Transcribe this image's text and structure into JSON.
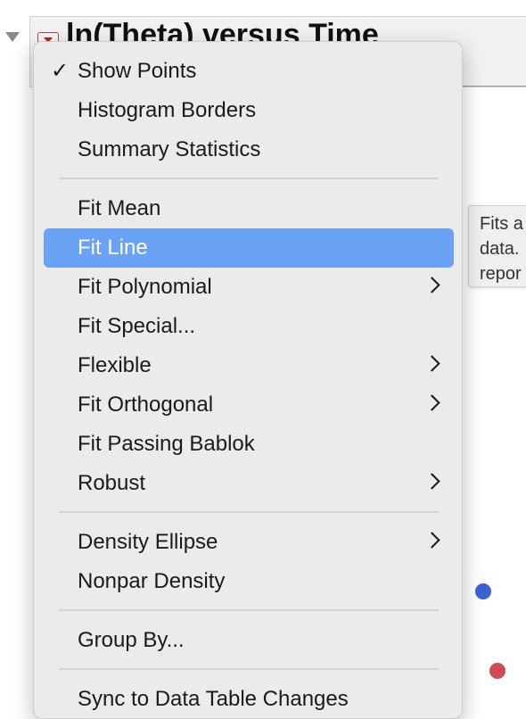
{
  "report": {
    "title": "ln(Theta) versus Time"
  },
  "tooltip": {
    "lines": [
      "Fits a",
      "data.",
      "repor"
    ]
  },
  "menu": {
    "items": [
      {
        "label": "Show Points",
        "checked": true,
        "check_glyph": "✓"
      },
      {
        "label": "Histogram Borders"
      },
      {
        "label": "Summary Statistics"
      },
      {
        "label": "Fit Mean"
      },
      {
        "label": "Fit Line",
        "selected": true
      },
      {
        "label": "Fit Polynomial",
        "submenu": true
      },
      {
        "label": "Fit Special..."
      },
      {
        "label": "Flexible",
        "submenu": true
      },
      {
        "label": "Fit Orthogonal",
        "submenu": true
      },
      {
        "label": "Fit Passing Bablok"
      },
      {
        "label": "Robust",
        "submenu": true
      },
      {
        "label": "Density Ellipse",
        "submenu": true
      },
      {
        "label": "Nonpar Density"
      },
      {
        "label": "Group By..."
      },
      {
        "label": "Sync to Data Table Changes"
      }
    ]
  },
  "colors": {
    "selection": "#6aa2f5",
    "point_blue": "#3d62d6",
    "point_red": "#d04a56"
  }
}
